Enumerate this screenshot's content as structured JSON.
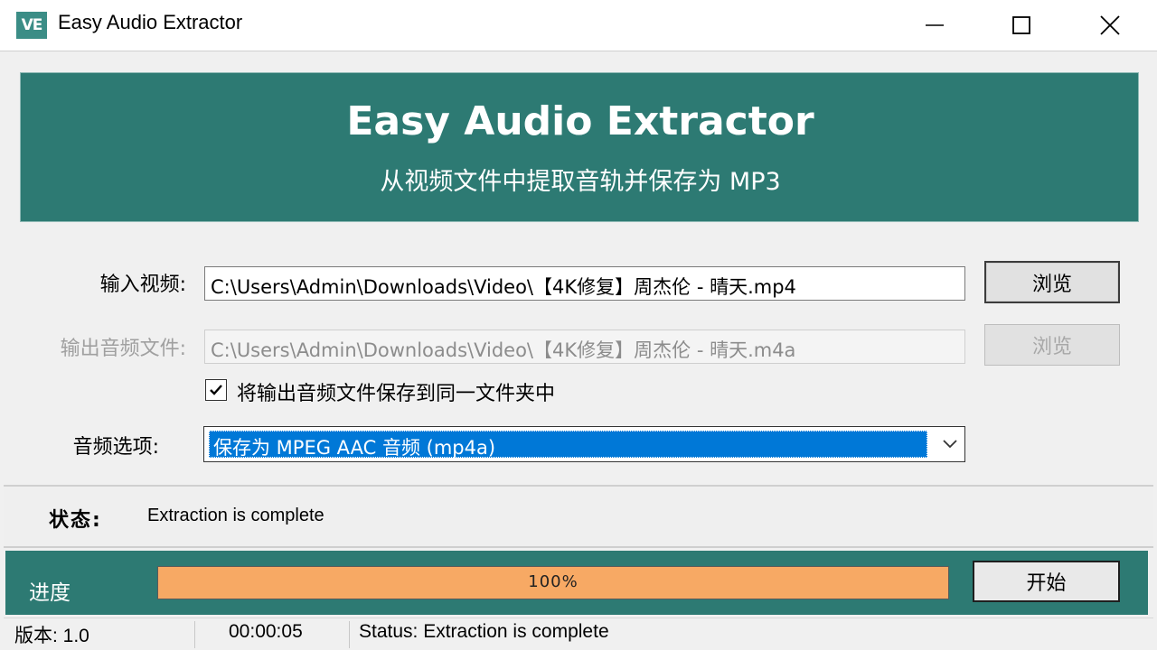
{
  "window": {
    "title": "Easy Audio Extractor",
    "icon_text": "VE",
    "controls": [
      "minimize-icon",
      "maximize-icon",
      "close-icon"
    ]
  },
  "banner": {
    "title": "Easy Audio Extractor",
    "subtitle": "从视频文件中提取音轨并保存为 MP3",
    "color": "#2d7a73"
  },
  "form": {
    "input_label": "输入视频:",
    "input_value": "C:\\Users\\Admin\\Downloads\\Video\\【4K修复】周杰伦 - 晴天.mp4",
    "browse_label": "浏览",
    "output_label": "输出音频文件:",
    "output_value": "C:\\Users\\Admin\\Downloads\\Video\\【4K修复】周杰伦 - 晴天.m4a",
    "output_browse_label": "浏览",
    "same_folder_checked": true,
    "same_folder_label": "将输出音频文件保存到同一文件夹中",
    "audio_label": "音频选项:",
    "audio_value": "保存为 MPEG AAC 音频 (mp4a)"
  },
  "status": {
    "label": "状态:",
    "text": "Extraction is complete"
  },
  "progress": {
    "label": "进度",
    "percent": 100,
    "percent_text": "100%",
    "fill_color": "#f7a964",
    "start_label": "开始"
  },
  "statusbar": {
    "version": "版本: 1.0",
    "elapsed": "00:00:05",
    "message": "Status: Extraction is complete"
  }
}
